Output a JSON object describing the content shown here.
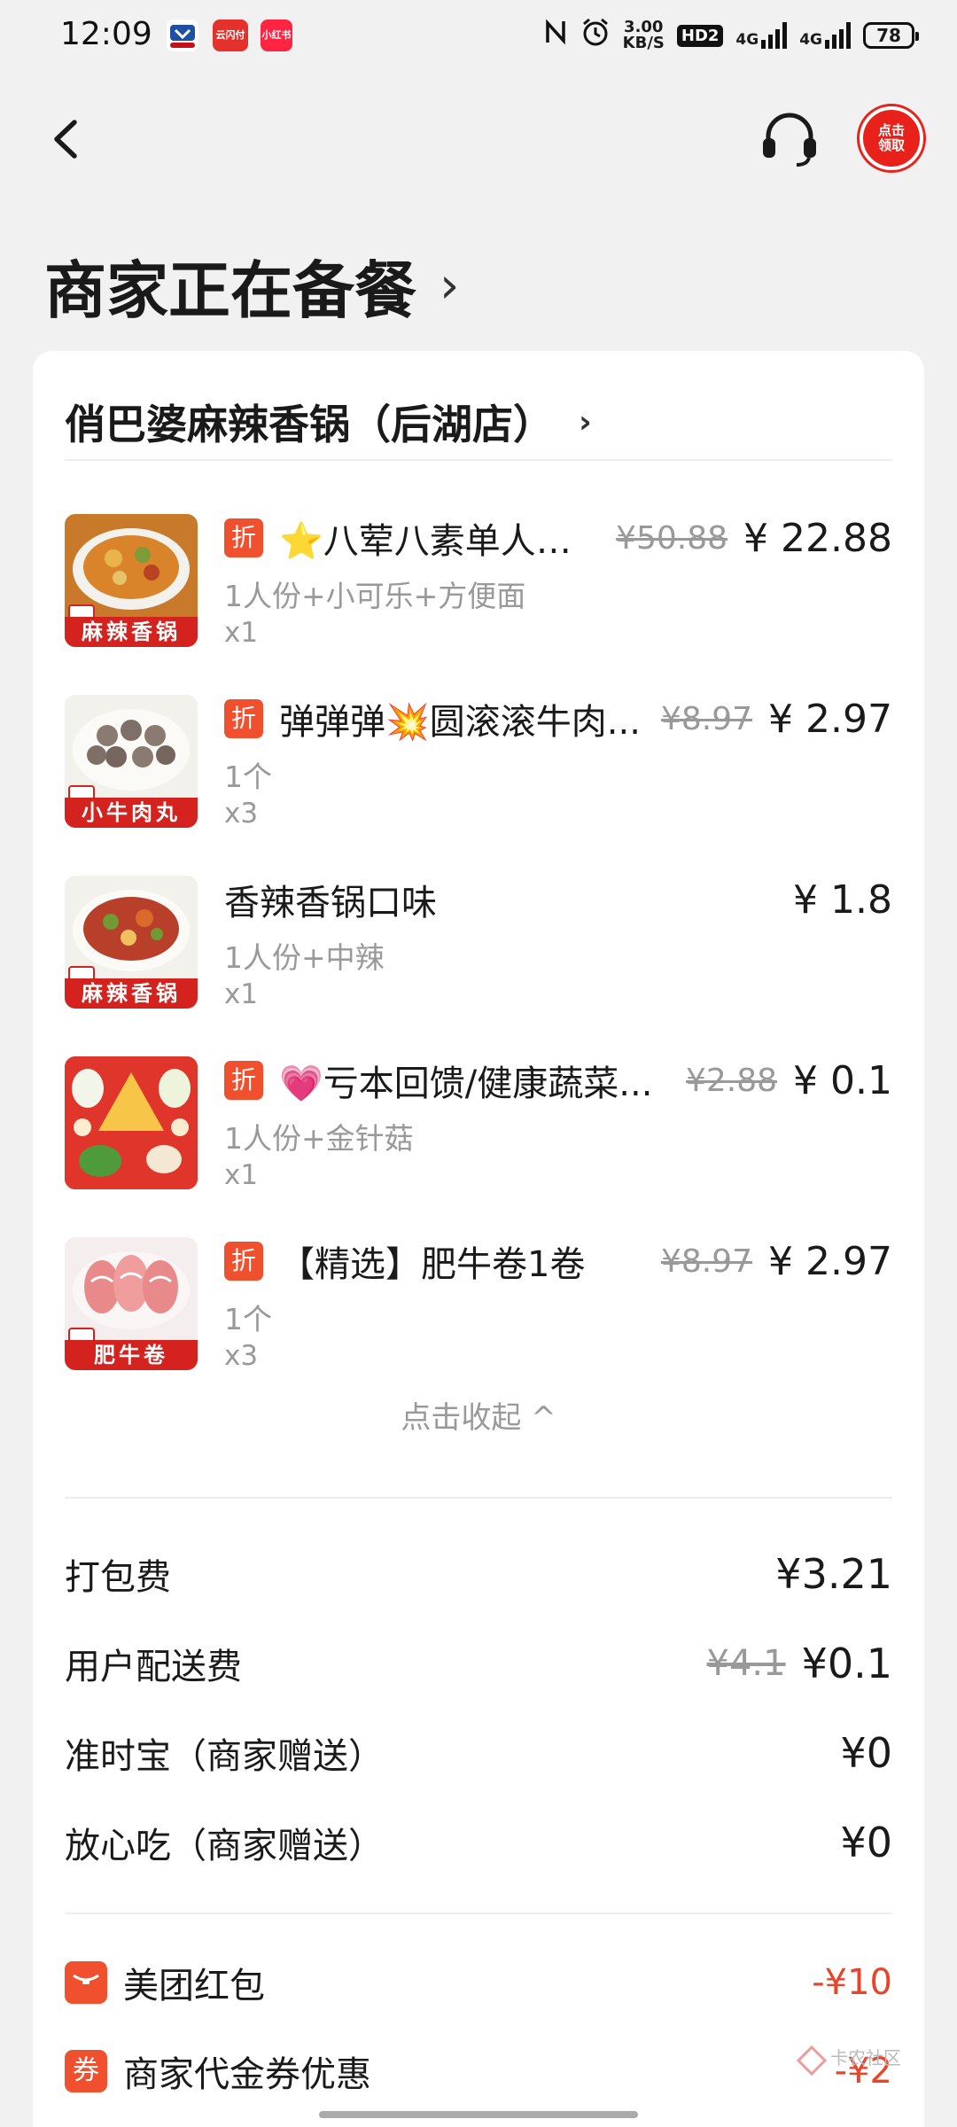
{
  "status_bar": {
    "time": "12:09",
    "apps": [
      {
        "name": "app-icon-1",
        "text": "",
        "color": "#c0141a"
      },
      {
        "name": "app-icon-2",
        "text": "云闪付",
        "color": "#e5312b"
      },
      {
        "name": "app-icon-3",
        "text": "小红书",
        "color": "#ff2442"
      }
    ],
    "net_speed": "3.00\nKB/S",
    "hd_badge": "HD2",
    "signal_1": "4G",
    "signal_2": "4G",
    "battery": "78"
  },
  "nav": {
    "coupon_label": "点击\n领取"
  },
  "order_status": {
    "title": "商家正在备餐",
    "chevron": "›"
  },
  "shop": {
    "name": "俏巴婆麻辣香锅（后湖店）",
    "chevron": "›"
  },
  "items": [
    {
      "tag": "折",
      "name": "⭐八荤八素单人餐...",
      "original_price": "¥50.88",
      "price": "¥ 22.88",
      "spec": "1人份+小可乐+方便面",
      "qty": "x1",
      "thumb_label": "麻辣香锅",
      "thumb_bg": "#c8792a"
    },
    {
      "tag": "折",
      "name": "弹弹弹💥圆滚滚牛肉...",
      "original_price": "¥8.97",
      "price": "¥ 2.97",
      "spec": "1个",
      "qty": "x3",
      "thumb_label": "小牛肉丸",
      "thumb_bg": "#8a7b72"
    },
    {
      "tag": "",
      "name": "香辣香锅口味",
      "original_price": "",
      "price": "¥ 1.8",
      "spec": "1人份+中辣",
      "qty": "x1",
      "thumb_label": "麻辣香锅",
      "thumb_bg": "#b8402a"
    },
    {
      "tag": "折",
      "name": "💗亏本回馈/健康蔬菜...",
      "original_price": "¥2.88",
      "price": "¥ 0.1",
      "spec": "1人份+金针菇",
      "qty": "x1",
      "thumb_label": "",
      "thumb_bg": "#e0352b"
    },
    {
      "tag": "折",
      "name": "【精选】肥牛卷1卷",
      "original_price": "¥8.97",
      "price": "¥ 2.97",
      "spec": "1个",
      "qty": "x3",
      "thumb_label": "肥牛卷",
      "thumb_bg": "#e98a8a"
    }
  ],
  "collapse_label": "点击收起 ^",
  "fees": [
    {
      "label": "打包费",
      "original": "",
      "value": "¥3.21"
    },
    {
      "label": "用户配送费",
      "original": "¥4.1",
      "value": "¥0.1"
    },
    {
      "label": "准时宝（商家赠送）",
      "original": "",
      "value": "¥0"
    },
    {
      "label": "放心吃（商家赠送）",
      "original": "",
      "value": "¥0"
    }
  ],
  "promos": [
    {
      "icon": "",
      "label": "美团红包",
      "value": "-¥10"
    },
    {
      "icon": "券",
      "label": "商家代金券优惠",
      "value": "-¥2"
    }
  ],
  "watermark": "卡农社区",
  "colors": {
    "accent": "#f0502d",
    "red_value": "#e8442a",
    "coupon_red": "#e8221b"
  }
}
